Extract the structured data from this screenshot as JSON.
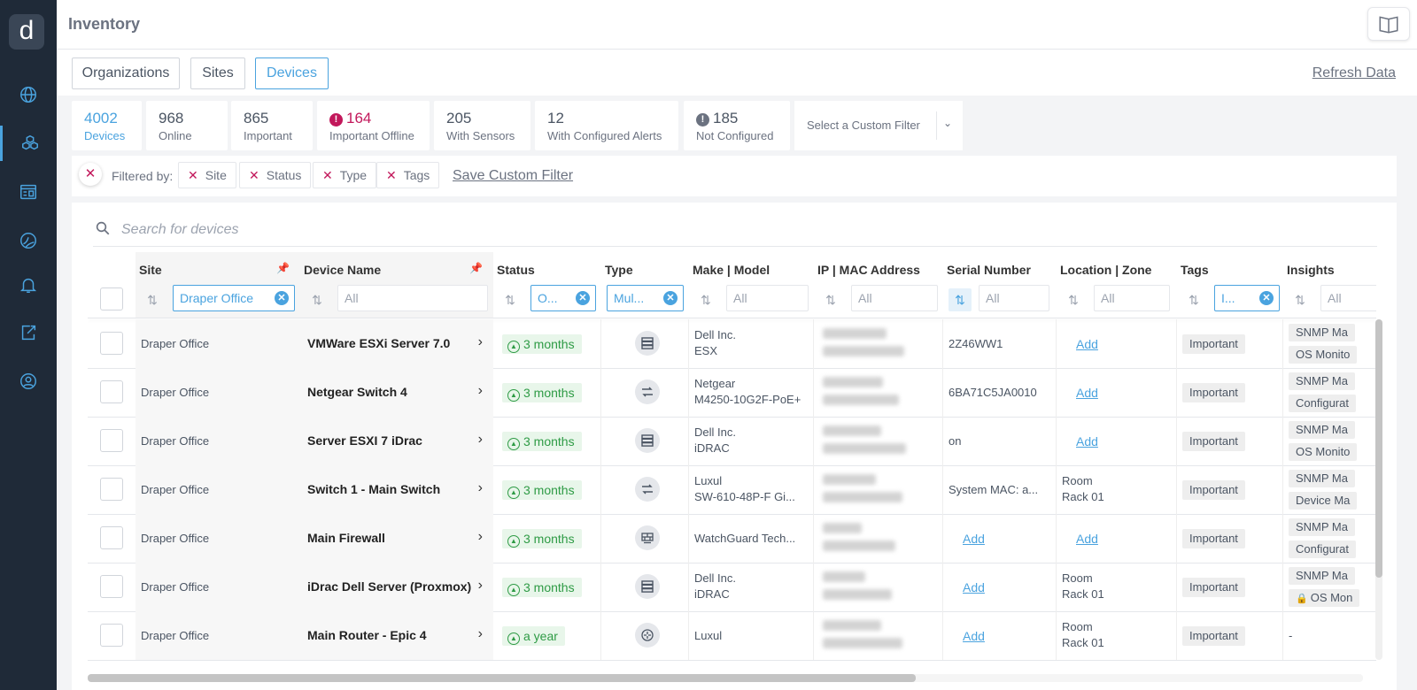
{
  "app": {
    "logo_letter": "d",
    "page_title": "Inventory"
  },
  "sidebar": {
    "items": [
      {
        "icon": "globe-icon"
      },
      {
        "icon": "cubes-icon",
        "active": true
      },
      {
        "icon": "dashboard-icon"
      },
      {
        "icon": "network-globe-icon"
      },
      {
        "icon": "bell-icon"
      },
      {
        "icon": "export-icon"
      },
      {
        "icon": "support-icon"
      }
    ]
  },
  "tabs": {
    "organizations": "Organizations",
    "sites": "Sites",
    "devices": "Devices",
    "refresh": "Refresh Data"
  },
  "stats": [
    {
      "value": "4002",
      "label": "Devices",
      "active": true
    },
    {
      "value": "968",
      "label": "Online"
    },
    {
      "value": "865",
      "label": "Important"
    },
    {
      "value": "164",
      "label": "Important Offline",
      "warn": true
    },
    {
      "value": "205",
      "label": "With Sensors"
    },
    {
      "value": "12",
      "label": "With Configured Alerts"
    },
    {
      "value": "185",
      "label": "Not Configured",
      "info": true
    }
  ],
  "custom_filter": {
    "placeholder": "Select a Custom Filter"
  },
  "filters": {
    "label": "Filtered by:",
    "chips": [
      "Site",
      "Status",
      "Type",
      "Tags"
    ],
    "save": "Save Custom Filter"
  },
  "search": {
    "placeholder": "Search for devices"
  },
  "columns": {
    "site": {
      "title": "Site",
      "filter": "Draper Office"
    },
    "device_name": {
      "title": "Device Name",
      "filter": "All"
    },
    "status": {
      "title": "Status",
      "filter": "O..."
    },
    "type": {
      "title": "Type",
      "filter": "Mul..."
    },
    "make_model": {
      "title": "Make | Model",
      "filter": "All"
    },
    "ip_mac": {
      "title": "IP | MAC Address",
      "filter": "All"
    },
    "serial": {
      "title": "Serial Number",
      "filter": "All"
    },
    "location": {
      "title": "Location | Zone",
      "filter": "All"
    },
    "tags": {
      "title": "Tags",
      "filter": "I..."
    },
    "insights": {
      "title": "Insights",
      "filter": "All"
    }
  },
  "rows": [
    {
      "site": "Draper Office",
      "name": "VMWare ESXi Server 7.0",
      "status": "3 months",
      "type_icon": "server-icon",
      "make": "Dell Inc.",
      "model": "ESX",
      "ip_add": "",
      "serial": "2Z46WW1",
      "loc1": "",
      "loc2": "",
      "loc_add": "Add",
      "tag": "Important",
      "ins1": "SNMP Ma",
      "ins2": "OS Monito",
      "ins2_lock": false
    },
    {
      "site": "Draper Office",
      "name": "Netgear Switch 4",
      "status": "3 months",
      "type_icon": "switch-icon",
      "make": "Netgear",
      "model": "M4250-10G2F-PoE+",
      "ip_add": "",
      "serial": "6BA71C5JA0010",
      "loc1": "",
      "loc2": "",
      "loc_add": "Add",
      "tag": "Important",
      "ins1": "SNMP Ma",
      "ins2": "Configurat",
      "ins2_lock": false
    },
    {
      "site": "Draper Office",
      "name": "Server ESXI 7 iDrac",
      "status": "3 months",
      "type_icon": "server-icon",
      "make": "Dell Inc.",
      "model": "iDRAC",
      "ip_add": "",
      "serial": "on",
      "loc1": "",
      "loc2": "",
      "loc_add": "Add",
      "tag": "Important",
      "ins1": "SNMP Ma",
      "ins2": "OS Monito",
      "ins2_lock": false
    },
    {
      "site": "Draper Office",
      "name": "Switch 1 - Main Switch",
      "status": "3 months",
      "type_icon": "switch-icon",
      "make": "Luxul",
      "model": "SW-610-48P-F Gi...",
      "ip_add": "",
      "serial": "System MAC: a...",
      "loc1": "Room",
      "loc2": "Rack 01",
      "loc_add": "",
      "tag": "Important",
      "ins1": "SNMP Ma",
      "ins2": "Device Ma",
      "ins2_lock": false
    },
    {
      "site": "Draper Office",
      "name": "Main Firewall",
      "status": "3 months",
      "type_icon": "firewall-icon",
      "make": "WatchGuard Tech...",
      "model": "",
      "ip_add": "",
      "serial_add": "Add",
      "serial": "",
      "loc1": "",
      "loc2": "",
      "loc_add": "Add",
      "tag": "Important",
      "ins1": "SNMP Ma",
      "ins2": "Configurat",
      "ins2_lock": false
    },
    {
      "site": "Draper Office",
      "name": "iDrac Dell Server (Proxmox)",
      "status": "3 months",
      "type_icon": "server-icon",
      "make": "Dell Inc.",
      "model": "iDRAC",
      "ip_add": "",
      "serial_add": "Add",
      "serial": "",
      "loc1": "Room",
      "loc2": "Rack 01",
      "loc_add": "",
      "tag": "Important",
      "ins1": "SNMP Ma",
      "ins2": "OS Mon",
      "ins2_lock": true
    },
    {
      "site": "Draper Office",
      "name": "Main Router - Epic 4",
      "status": "a year",
      "type_icon": "router-icon",
      "make": "Luxul",
      "model": "",
      "ip_add": "",
      "serial_add": "Add",
      "serial": "",
      "loc1": "Room",
      "loc2": "Rack 01",
      "loc_add": "",
      "tag": "Important",
      "ins1": "-",
      "ins2": "",
      "ins2_lock": false
    }
  ],
  "colors": {
    "accent": "#4aa3df",
    "warn": "#c2185b",
    "sidebar": "#1f2a38",
    "status_ok": "#2e9b45"
  }
}
